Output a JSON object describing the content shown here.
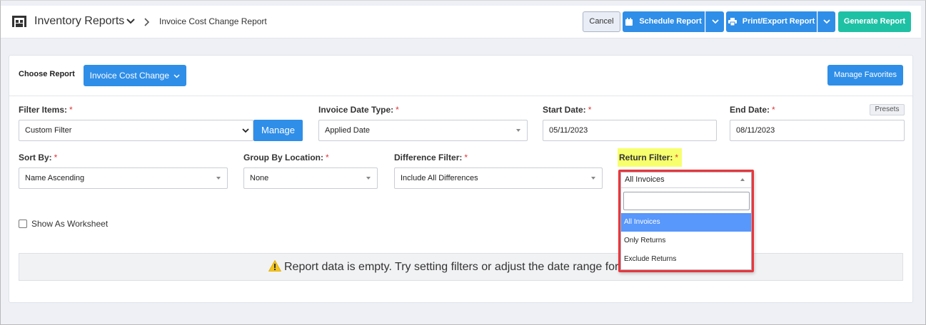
{
  "header": {
    "app_title": "Inventory Reports",
    "breadcrumb": "Invoice Cost Change Report",
    "cancel_label": "Cancel",
    "schedule_label": "Schedule Report",
    "print_label": "Print/Export Report",
    "generate_label": "Generate Report"
  },
  "report": {
    "choose_label": "Choose Report",
    "selected_report": "Invoice Cost Change",
    "manage_favorites_label": "Manage Favorites"
  },
  "filters": {
    "filter_items": {
      "label": "Filter Items:",
      "value": "Custom Filter",
      "manage_label": "Manage"
    },
    "invoice_date_type": {
      "label": "Invoice Date Type:",
      "value": "Applied Date"
    },
    "start_date": {
      "label": "Start Date:",
      "value": "05/11/2023"
    },
    "end_date": {
      "label": "End Date:",
      "value": "08/11/2023",
      "presets_label": "Presets"
    },
    "sort_by": {
      "label": "Sort By:",
      "value": "Name Ascending"
    },
    "group_by_location": {
      "label": "Group By Location:",
      "value": "None"
    },
    "difference_filter": {
      "label": "Difference Filter:",
      "value": "Include All Differences"
    },
    "return_filter": {
      "label": "Return Filter:",
      "value": "All Invoices",
      "search_value": "",
      "options": [
        "All Invoices",
        "Only Returns",
        "Exclude Returns"
      ],
      "selected_index": 0
    },
    "required_mark": "*"
  },
  "worksheet": {
    "label": "Show As Worksheet",
    "checked": false
  },
  "message": {
    "empty_text": "Report data is empty. Try setting filters or adjust the date range for r"
  },
  "colors": {
    "primary": "#2f8ee8",
    "success": "#1fc1a5",
    "highlight": "#f7ff6e",
    "annotation": "#e8373c",
    "warning_icon": "#f5c518"
  }
}
